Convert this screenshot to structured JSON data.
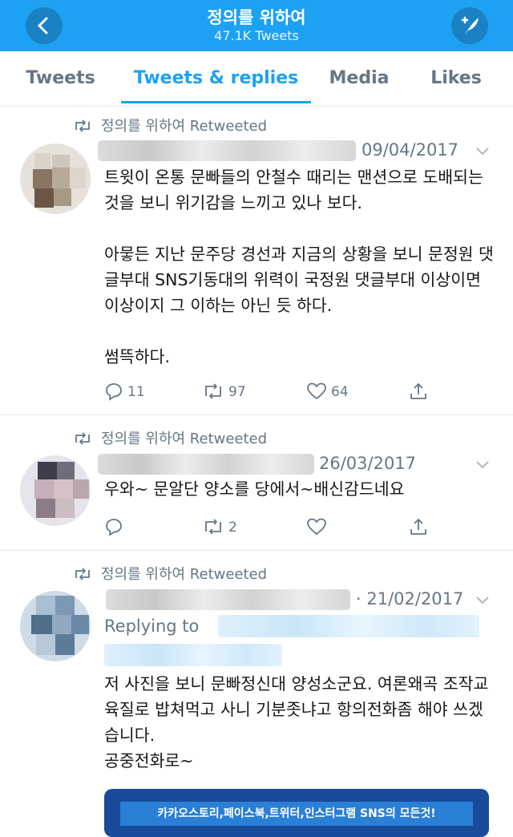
{
  "header": {
    "title": "정의를 위하여",
    "subtitle": "47.1K Tweets"
  },
  "tabs": [
    {
      "label": "Tweets"
    },
    {
      "label": "Tweets & replies"
    },
    {
      "label": "Media"
    },
    {
      "label": "Likes"
    }
  ],
  "active_tab": "Tweets & replies",
  "colors": {
    "brand": "#1da1f2",
    "secondary_text": "#657786"
  },
  "icons": {
    "back": "chevron-left-icon",
    "compose": "compose-feather-icon",
    "retweeted": "retweet-icon",
    "reply": "reply-icon",
    "retweet": "retweet-icon",
    "like": "heart-icon",
    "share": "share-icon"
  },
  "tweets": [
    {
      "retweet_label": "정의를 위하여 Retweeted",
      "date": "09/04/2017",
      "body": "트윗이 온통 문빠들의 안철수 때리는 맨션으로 도배되는 것을 보니 위기감을 느끼고 있나 보다.\n\n아뭏든 지난 문주당 경선과 지금의 상황을 보니 문정원 댓글부대 SNS기동대의 위력이 국정원 댓글부대 이상이면 이상이지 그 이하는 아닌 듯 하다.\n\n썸뜩하다.",
      "replies": "11",
      "retweets": "97",
      "likes": "64"
    },
    {
      "retweet_label": "정의를 위하여 Retweeted",
      "date": "26/03/2017",
      "body": "우와~ 문알단 양소를 당에서~배신감드네요",
      "replies": "",
      "retweets": "2",
      "likes": ""
    },
    {
      "retweet_label": "정의를 위하여 Retweeted",
      "date": "· 21/02/2017",
      "replying_to": "Replying to",
      "body": "저 사진을 보니  문빠정신대 양성소군요. 여론왜곡 조작교육질로 밥쳐먹고 사니 기분좃냐고 항의전화좀 해야 쓰겠습니다.\n공중전화로~",
      "image_caption": "카카오스토리,페이스북,트위터,인스터그램 SNS의 모든것!"
    }
  ]
}
